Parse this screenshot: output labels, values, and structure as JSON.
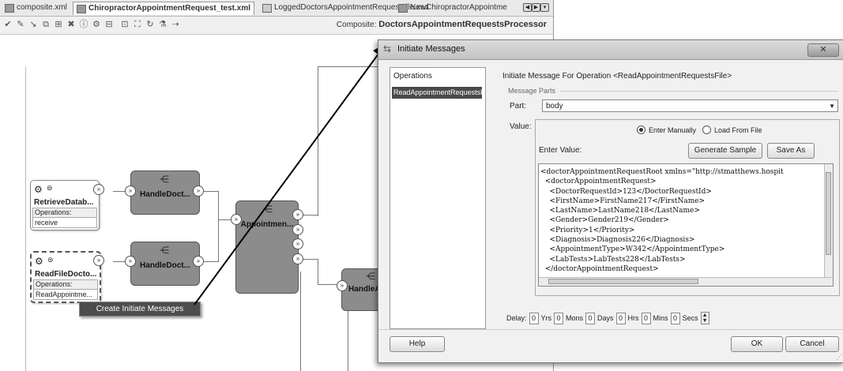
{
  "tabs": [
    {
      "label": "composite.xml"
    },
    {
      "label": "ChiropractorAppointmentRequest_test.xml"
    },
    {
      "label": "LoggedDoctorsAppointmentRequestFile.xsd"
    },
    {
      "label": "NewChiropractorAppointme"
    }
  ],
  "toolbar": {
    "composite_prefix": "Composite:",
    "composite_name": "DoctorsAppointmentRequestsProcessor"
  },
  "canvas": {
    "service1": {
      "title": "RetrieveDatab...",
      "ops_label": "Operations:",
      "ops_value": "receive"
    },
    "service2": {
      "title": "ReadFileDocto...",
      "ops_label": "Operations:",
      "ops_value": "ReadAppointme..."
    },
    "comp1": {
      "label": "HandleDoct..."
    },
    "comp2": {
      "label": "HandleDoct..."
    },
    "comp3": {
      "label": "Appointmen..."
    },
    "comp4": {
      "label": "HandleA"
    }
  },
  "context_menu": {
    "item": "Create Initiate Messages"
  },
  "dialog": {
    "title": "Initiate Messages",
    "operations_header": "Operations",
    "operation_item": "ReadAppointmentRequestsFile",
    "heading": "Initiate Message For Operation <ReadAppointmentRequestsFile>",
    "message_parts_label": "Message Parts",
    "part_label": "Part:",
    "part_value": "body",
    "value_label": "Value:",
    "radio_manual": "Enter Manually",
    "radio_file": "Load From File",
    "radio_selected": "manual",
    "enter_value_label": "Enter Value:",
    "generate_sample": "Generate Sample",
    "save_as": "Save As",
    "xml_lines": [
      "<doctorAppointmentRequestRoot xmlns=\"http://stmatthews.hospit",
      "  <doctorAppointmentRequest>",
      "    <DoctorRequestId>123</DoctorRequestId>",
      "    <FirstName>FirstName217</FirstName>",
      "    <LastName>LastName218</LastName>",
      "    <Gender>Gender219</Gender>",
      "    <Priority>1</Priority>",
      "    <Diagnosis>Diagnosis226</Diagnosis>",
      "    <AppointmentType>W342</AppointmentType>",
      "    <LabTests>LabTests228</LabTests>",
      "  </doctorAppointmentRequest>"
    ],
    "delay_label": "Delay:",
    "delay": [
      {
        "value": "0",
        "unit": "Yrs"
      },
      {
        "value": "0",
        "unit": "Mons"
      },
      {
        "value": "0",
        "unit": "Days"
      },
      {
        "value": "0",
        "unit": "Hrs"
      },
      {
        "value": "0",
        "unit": "Mins"
      },
      {
        "value": "0",
        "unit": "Secs"
      }
    ],
    "help_button": "Help",
    "ok_button": "OK",
    "cancel_button": "Cancel"
  }
}
